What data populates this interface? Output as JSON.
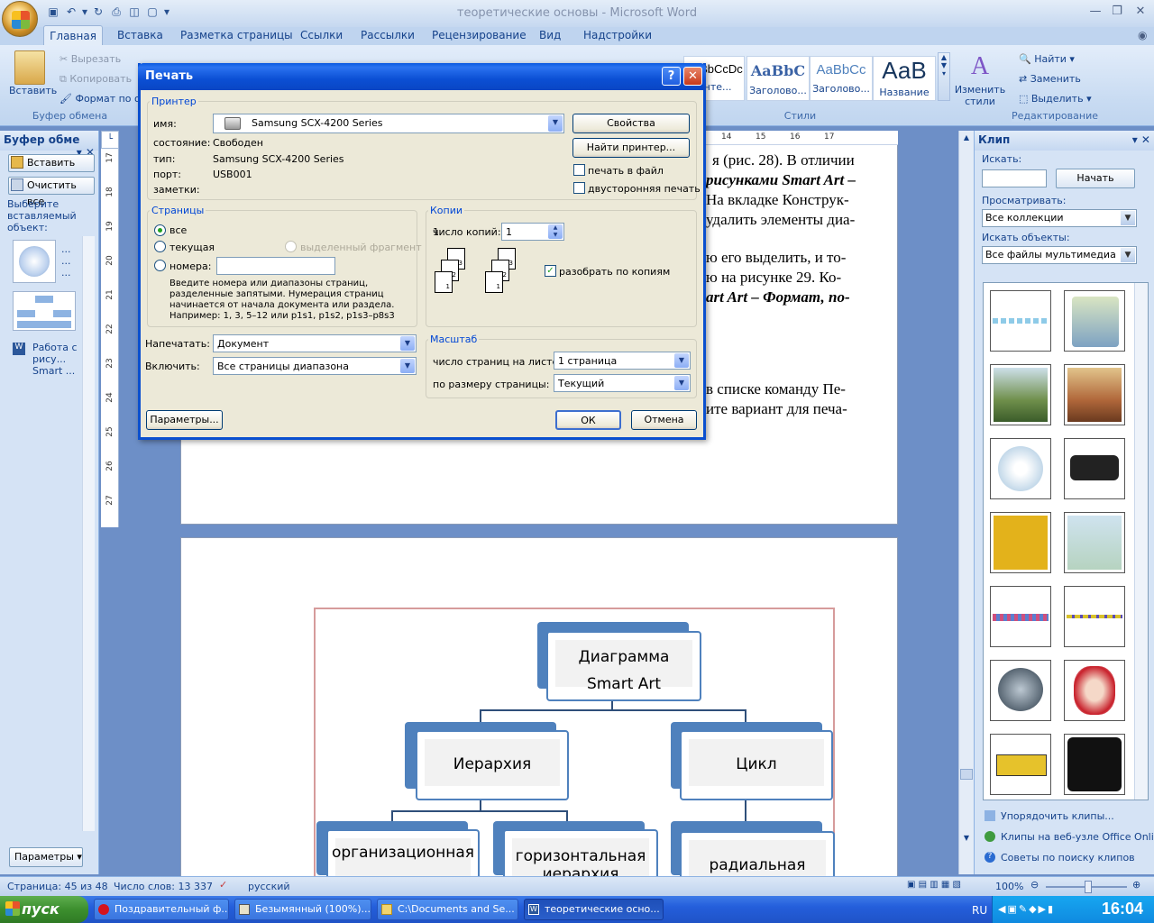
{
  "app": {
    "window_title": "теоретические основы - Microsoft Word"
  },
  "ribbon": {
    "tabs": [
      "Главная",
      "Вставка",
      "Разметка страницы",
      "Ссылки",
      "Рассылки",
      "Рецензирование",
      "Вид",
      "Надстройки"
    ],
    "clipboard": {
      "paste": "Вставить",
      "cut": "Вырезать",
      "copy": "Копировать",
      "format_painter": "Формат по об",
      "group_label": "Буфер обмена"
    },
    "styles": [
      {
        "preview": "AaBbCcDc",
        "name": "Инте..."
      },
      {
        "preview": "AaBbC",
        "name": "Заголово..."
      },
      {
        "preview": "AaBbCc",
        "name": "Заголово..."
      },
      {
        "preview": "АаВ",
        "name": "Название"
      }
    ],
    "change_styles": "Изменить стили",
    "styles_group_label": "Стили",
    "editing": {
      "find": "Найти",
      "replace": "Заменить",
      "select": "Выделить",
      "group_label": "Редактирование"
    }
  },
  "left_pane": {
    "title": "Буфер обме",
    "paste_all": "Вставить все",
    "clear_all": "Очистить все",
    "hint": "Выберите вставляемый объект:",
    "item_dots_1": "...",
    "item_dots_2": "...",
    "item_dots_3": "...",
    "item_text": "Работа с рису... Smart ...",
    "options": "Параметры"
  },
  "ruler": {
    "vertical_ticks": [
      "17",
      "18",
      "19",
      "20",
      "21",
      "22",
      "23",
      "24",
      "25",
      "26",
      "27"
    ],
    "horizontal_ticks": [
      "14",
      "15",
      "16",
      "17"
    ]
  },
  "document": {
    "lines": [
      "я (рис. 28). В отличии",
      "рисунками Smart Art –",
      "На вкладке Конструк-",
      "удалить элементы диа-",
      "ю его выделить, и то-",
      "ю на рисунке 29. Ко-",
      "art Art – Формат, по-",
      "в списке команду Пе-",
      "ите вариант для печа-"
    ],
    "smartart": {
      "root": "Диаграмма Smart Art",
      "left": "Иерархия",
      "right": "Цикл",
      "bottom_left": "организационная",
      "bottom_mid": "горизонтальная иерархия",
      "bottom_right": "радиальная"
    }
  },
  "right_pane": {
    "title": "Клип",
    "search_label": "Искать:",
    "search_value": "",
    "go_button": "Начать",
    "browse_label": "Просматривать:",
    "browse_value": "Все коллекции",
    "objects_label": "Искать объекты:",
    "objects_value": "Все файлы мультимедиа",
    "links": [
      "Упорядочить клипы...",
      "Клипы на веб-узле Office Online",
      "Советы по поиску клипов"
    ]
  },
  "print_dialog": {
    "title": "Печать",
    "printer_section": "Принтер",
    "name_label": "имя:",
    "printer_name": "Samsung SCX-4200 Series",
    "status_label": "состояние:",
    "status_value": "Свободен",
    "type_label": "тип:",
    "type_value": "Samsung SCX-4200 Series",
    "port_label": "порт:",
    "port_value": "USB001",
    "notes_label": "заметки:",
    "properties_button": "Свойства",
    "find_printer_button": "Найти принтер...",
    "print_to_file": "печать в файл",
    "duplex": "двусторонняя печать",
    "pages_section": "Страницы",
    "all": "все",
    "current": "текущая",
    "selection": "выделенный фрагмент",
    "numbers": "номера:",
    "pages_hint": "Введите номера или диапазоны страниц, разделенные запятыми. Нумерация страниц начинается от начала документа или раздела. Например: 1, 3, 5–12 или p1s1, p1s2, p1s3–p8s3",
    "copies_section": "Копии",
    "copies_label": "число копий:",
    "copies_value": "1",
    "collate": "разобрать по копиям",
    "print_what_label": "Напечатать:",
    "print_what_value": "Документ",
    "include_label": "Включить:",
    "include_value": "Все страницы диапазона",
    "zoom_section": "Масштаб",
    "pages_per_sheet_label": "число страниц на листе:",
    "pages_per_sheet_value": "1 страница",
    "scale_label": "по размеру страницы:",
    "scale_value": "Текущий",
    "options_button": "Параметры...",
    "ok_button": "ОК",
    "cancel_button": "Отмена"
  },
  "statusbar": {
    "page": "Страница: 45 из 48",
    "words": "Число слов: 13 337",
    "language": "русский",
    "zoom": "100%"
  },
  "taskbar": {
    "start": "пуск",
    "tasks": [
      "Поздравительный ф...",
      "Безымянный (100%)...",
      "C:\\Documents and Se...",
      "теоретические осно..."
    ],
    "lang": "RU",
    "time": "16:04"
  }
}
